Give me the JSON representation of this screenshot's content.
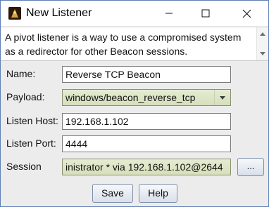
{
  "window": {
    "title": "New Listener",
    "icon": "cobalt-strike-app-icon",
    "controls": [
      "minimize-icon",
      "maximize-icon",
      "close-icon"
    ]
  },
  "description": "A pivot listener is a way to use a compromised system as a redirector for other Beacon sessions.",
  "form": {
    "name_label": "Name:",
    "name_value": "Reverse TCP Beacon",
    "payload_label": "Payload:",
    "payload_value": "windows/beacon_reverse_tcp",
    "listen_host_label": "Listen Host:",
    "listen_host_value": "192.168.1.102",
    "listen_port_label": "Listen Port:",
    "listen_port_value": "4444",
    "session_label": "Session",
    "session_value": "inistrator * via  192.168.1.102@2644",
    "browse_label": "..."
  },
  "buttons": {
    "save": "Save",
    "help": "Help"
  }
}
